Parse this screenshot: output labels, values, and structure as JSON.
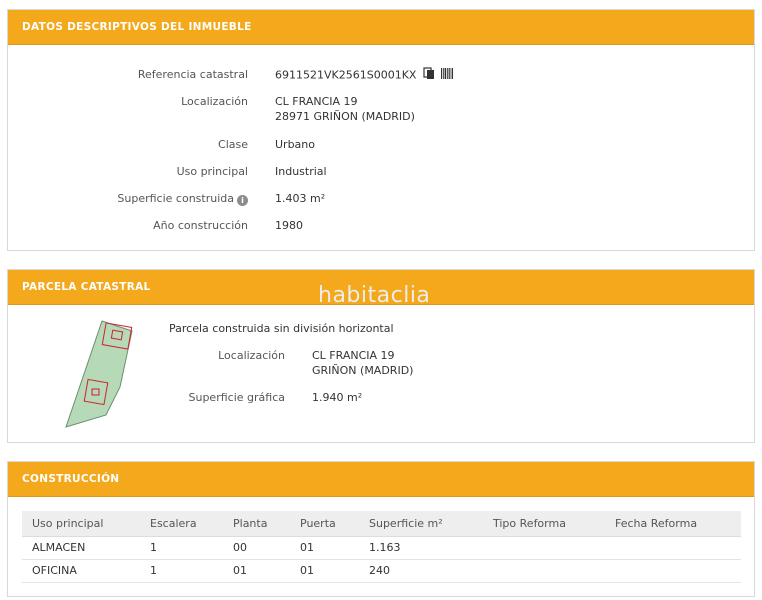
{
  "inmueble": {
    "header": "DATOS DESCRIPTIVOS DEL INMUEBLE",
    "fields": [
      {
        "label": "Referencia catastral",
        "value": "6911521VK2561S0001KX"
      },
      {
        "label": "Localización",
        "value": "CL FRANCIA 19",
        "value2": "28971 GRIÑON (MADRID)"
      },
      {
        "label": "Clase",
        "value": "Urbano"
      },
      {
        "label": "Uso principal",
        "value": "Industrial"
      },
      {
        "label": "Superficie construida",
        "value": "1.403 m²"
      },
      {
        "label": "Año construcción",
        "value": "1980"
      }
    ],
    "icons": [
      "copy-icon",
      "barcode-icon",
      "info-icon"
    ]
  },
  "parcela": {
    "header": "PARCELA CATASTRAL",
    "watermark": "habitaclia",
    "description": "Parcela construida sin división horizontal",
    "fields": [
      {
        "label": "Localización",
        "value": "CL FRANCIA 19",
        "value2": "GRIÑON (MADRID)"
      },
      {
        "label": "Superficie gráfica",
        "value": "1.940 m²"
      }
    ]
  },
  "construccion": {
    "header": "CONSTRUCCIÓN",
    "columns": [
      "Uso principal",
      "Escalera",
      "Planta",
      "Puerta",
      "Superficie m²",
      "Tipo Reforma",
      "Fecha Reforma"
    ],
    "rows": [
      [
        "ALMACEN",
        "1",
        "00",
        "01",
        "1.163",
        "",
        ""
      ],
      [
        "OFICINA",
        "1",
        "01",
        "01",
        "240",
        "",
        ""
      ]
    ]
  },
  "colors": {
    "accent": "#f4a81b",
    "plot_fill": "#b6d9b8",
    "plot_outline": "#d2202a"
  }
}
